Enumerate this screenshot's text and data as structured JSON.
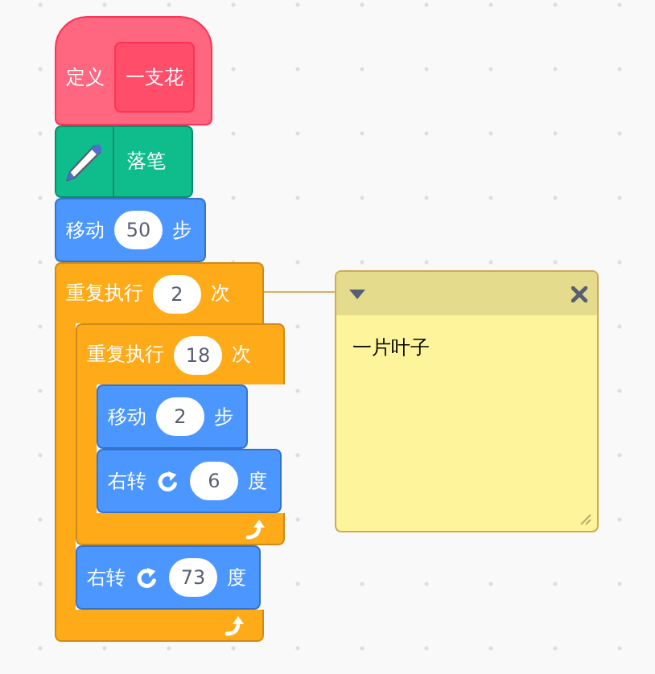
{
  "script": {
    "blocks": [
      {
        "kind": "define",
        "label": "定义",
        "name": "一支花"
      },
      {
        "kind": "pen",
        "label": "落笔"
      },
      {
        "kind": "move",
        "label": "移动",
        "value": "50",
        "unit": "步"
      },
      {
        "kind": "repeat",
        "label": "重复执行",
        "value": "2",
        "unit": "次",
        "children": [
          {
            "kind": "repeat",
            "label": "重复执行",
            "value": "18",
            "unit": "次",
            "children": [
              {
                "kind": "move",
                "label": "移动",
                "value": "2",
                "unit": "步"
              },
              {
                "kind": "turn",
                "label": "右转",
                "value": "6",
                "unit": "度"
              }
            ]
          },
          {
            "kind": "turn",
            "label": "右转",
            "value": "73",
            "unit": "度"
          }
        ]
      }
    ]
  },
  "comment": {
    "text": "一片叶子"
  }
}
